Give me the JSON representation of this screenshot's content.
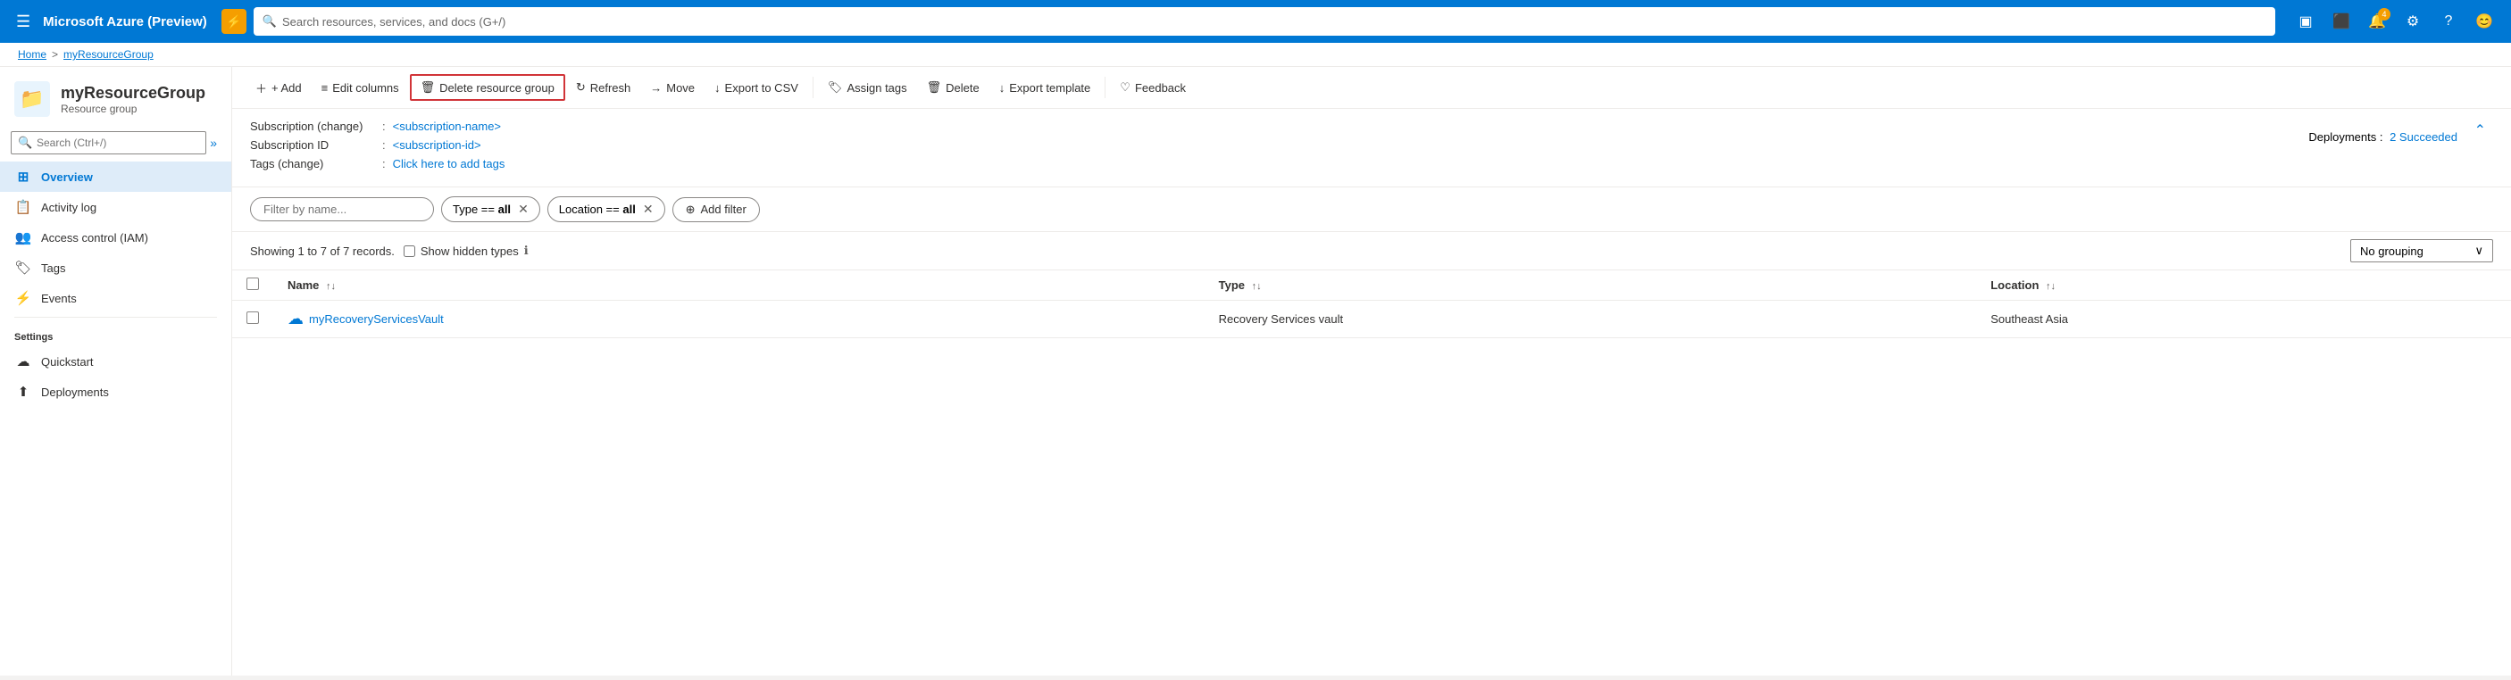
{
  "app": {
    "title": "Microsoft Azure (Preview)",
    "search_placeholder": "Search resources, services, and docs (G+/)",
    "alert_icon": "⚡",
    "nav_icons": [
      "▣",
      "⬛",
      "🔔",
      "⚙",
      "?",
      "😊"
    ],
    "notification_badge": "4"
  },
  "breadcrumb": {
    "home": "Home",
    "separator": ">",
    "current": "myResourceGroup"
  },
  "resource_header": {
    "icon": "📁",
    "name": "myResourceGroup",
    "type": "Resource group"
  },
  "sidebar": {
    "search_placeholder": "Search (Ctrl+/)",
    "items": [
      {
        "label": "Overview",
        "icon": "⊞",
        "active": true
      },
      {
        "label": "Activity log",
        "icon": "📋",
        "active": false
      },
      {
        "label": "Access control (IAM)",
        "icon": "👥",
        "active": false
      },
      {
        "label": "Tags",
        "icon": "🏷",
        "active": false
      },
      {
        "label": "Events",
        "icon": "⚡",
        "active": false
      }
    ],
    "settings_section": "Settings",
    "settings_items": [
      {
        "label": "Quickstart",
        "icon": "☁"
      },
      {
        "label": "Deployments",
        "icon": "⬆"
      }
    ]
  },
  "toolbar": {
    "add_label": "+ Add",
    "edit_columns_label": "Edit columns",
    "delete_label": "Delete resource group",
    "refresh_label": "Refresh",
    "move_label": "Move",
    "export_csv_label": "Export to CSV",
    "assign_tags_label": "Assign tags",
    "delete2_label": "Delete",
    "export_template_label": "Export template",
    "feedback_label": "Feedback"
  },
  "info": {
    "subscription_label": "Subscription (change)",
    "subscription_value": "<subscription-name>",
    "subscription_id_label": "Subscription ID",
    "subscription_id_value": "<subscription-id>",
    "tags_label": "Tags (change)",
    "tags_value": "Click here to add tags",
    "deployments_label": "Deployments :",
    "deployments_value": "2 Succeeded"
  },
  "filters": {
    "filter_placeholder": "Filter by name...",
    "type_filter": "Type == all",
    "location_filter": "Location == all",
    "add_filter_label": "Add filter"
  },
  "records": {
    "text": "Showing 1 to 7 of 7 records.",
    "show_hidden_label": "Show hidden types",
    "grouping_label": "No grouping"
  },
  "table": {
    "columns": [
      {
        "label": "Name",
        "sortable": true
      },
      {
        "label": "Type",
        "sortable": true
      },
      {
        "label": "Location",
        "sortable": true
      }
    ],
    "rows": [
      {
        "name": "myRecoveryServicesVault",
        "type": "Recovery Services vault",
        "location": "Southeast Asia",
        "icon": "☁",
        "icon_color": "#0078d4"
      }
    ]
  }
}
